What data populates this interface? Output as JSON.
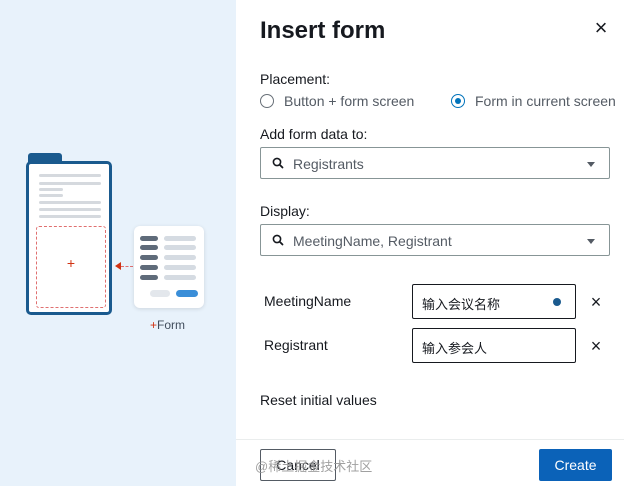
{
  "illustration": {
    "drop_plus": "+",
    "caption_plus": "+",
    "caption_text": "Form"
  },
  "dialog": {
    "title": "Insert form",
    "close_icon": "close-icon"
  },
  "placement": {
    "label": "Placement:",
    "options": [
      {
        "label": "Button + form screen",
        "selected": false
      },
      {
        "label": "Form in current screen",
        "selected": true
      }
    ]
  },
  "form_data": {
    "label": "Add form data to:",
    "value": "Registrants"
  },
  "display": {
    "label": "Display:",
    "value": "MeetingName, Registrant"
  },
  "fields": [
    {
      "label": "MeetingName",
      "placeholder": "输入会议名称"
    },
    {
      "label": "Registrant",
      "placeholder": "输入参会人"
    }
  ],
  "reset_label": "Reset initial values",
  "footer": {
    "cancel_label": "Cancel",
    "create_label": "Create"
  },
  "watermark": "@稀土掘金技术社区",
  "colors": {
    "accent": "#0073bb",
    "primary_button": "#0b62b8",
    "panel_bg": "#e8f2fb",
    "doc_border": "#1a5a8e",
    "drop_accent": "#d13212"
  }
}
